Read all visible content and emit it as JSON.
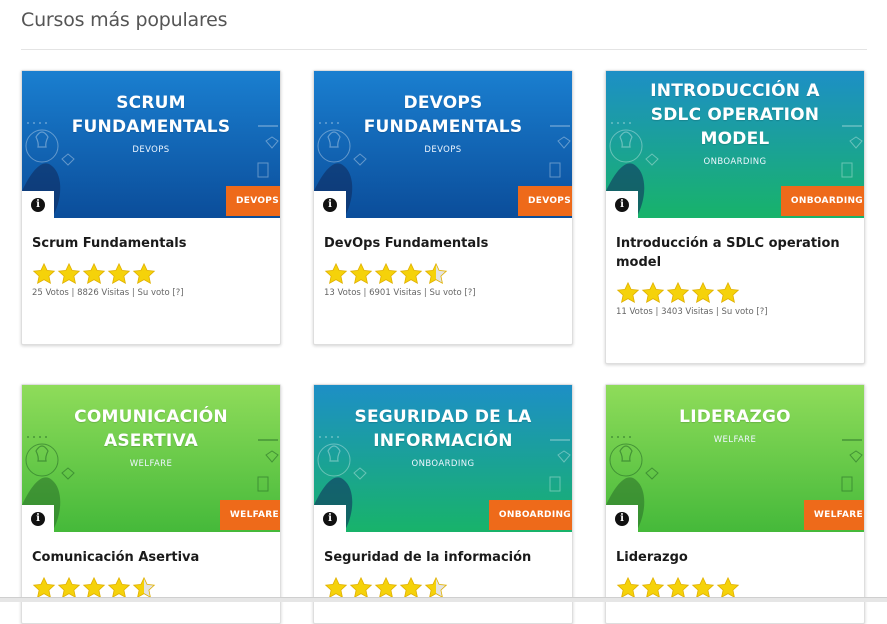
{
  "section": {
    "title": "Cursos más populares"
  },
  "courses": [
    {
      "banner_title": "SCRUM\nFUNDAMENTALS",
      "banner_subtitle": "DEVOPS",
      "category": "DEVOPS",
      "title": "Scrum Fundamentals",
      "rating": 5,
      "meta": "25 Votos | 8826 Visitas | Su voto [?]",
      "theme": "blue"
    },
    {
      "banner_title": "DEVOPS\nFUNDAMENTALS",
      "banner_subtitle": "DEVOPS",
      "category": "DEVOPS",
      "title": "DevOps Fundamentals",
      "rating": 4.5,
      "meta": "13 Votos | 6901 Visitas | Su voto [?]",
      "theme": "blue"
    },
    {
      "banner_title": "INTRODUCCIÓN A\nSDLC OPERATION\nMODEL",
      "banner_subtitle": "ONBOARDING",
      "category": "ONBOARDING",
      "title": "Introducción a SDLC operation model",
      "rating": 5,
      "meta": "11 Votos | 3403 Visitas | Su voto [?]",
      "theme": "teal"
    },
    {
      "banner_title": "COMUNICACIÓN\nASERTIVA",
      "banner_subtitle": "WELFARE",
      "category": "WELFARE",
      "title": "Comunicación Asertiva",
      "rating": 4.5,
      "meta": "",
      "theme": "green"
    },
    {
      "banner_title": "SEGURIDAD DE LA\nINFORMACIÓN",
      "banner_subtitle": "ONBOARDING",
      "category": "ONBOARDING",
      "title": "Seguridad de la información",
      "rating": 4.5,
      "meta": "",
      "theme": "teal"
    },
    {
      "banner_title": "LIDERAZGO",
      "banner_subtitle": "WELFARE",
      "category": "WELFARE",
      "title": "Liderazgo",
      "rating": 5,
      "meta": "",
      "theme": "green"
    }
  ],
  "colors": {
    "blue_top": "#1a7fd0",
    "blue_bottom": "#0b4d9a",
    "teal_top": "#1d8fc6",
    "teal_bottom": "#18b36a",
    "green_top": "#8fdc5a",
    "green_bottom": "#45b93a",
    "tag": "#ee6a1a",
    "star": "#f5d20a"
  },
  "icons": {
    "info": "info-icon",
    "star": "star-icon"
  }
}
